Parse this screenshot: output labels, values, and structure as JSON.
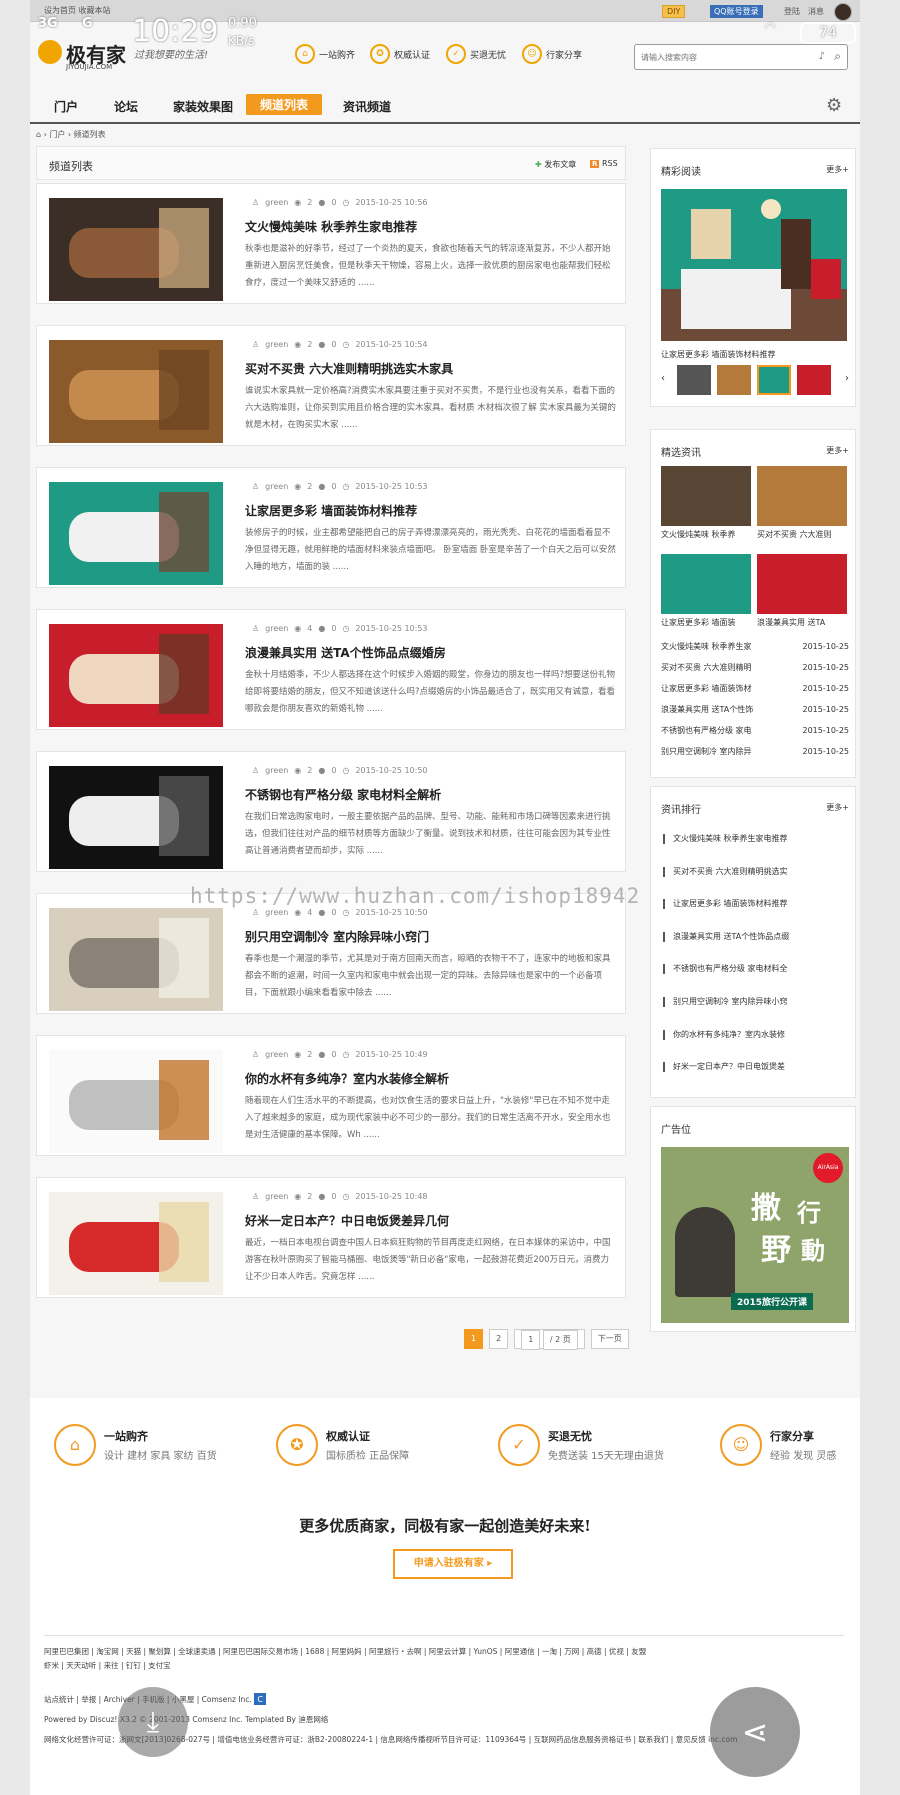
{
  "status_bar": {
    "network1": "3G",
    "network2": "G",
    "time": "10:29",
    "speed": "0.90",
    "speed_unit": "KB/s",
    "battery": "74",
    "top_left": "设为首页  收藏本站"
  },
  "topbar": {
    "diy": "DIY",
    "qq": "QQ账号登录",
    "login": "登陆",
    "message": "消息"
  },
  "logo": {
    "name": "极有家",
    "sub": "JIYOUJIA.COM",
    "slogan": "过我想要的生活!"
  },
  "features": [
    {
      "label": "一站购齐"
    },
    {
      "label": "权威认证"
    },
    {
      "label": "买退无忧"
    },
    {
      "label": "行家分享"
    }
  ],
  "search": {
    "placeholder": "请输入搜索内容"
  },
  "nav": [
    {
      "label": "门户"
    },
    {
      "label": "论坛"
    },
    {
      "label": "家装效果图"
    },
    {
      "label": "频道列表"
    },
    {
      "label": "资讯频道"
    }
  ],
  "breadcrumb": {
    "home": "门户",
    "current": "频道列表"
  },
  "main": {
    "title": "频道列表",
    "post": "发布文章",
    "rss": "RSS",
    "articles": [
      {
        "author": "green",
        "views": "2",
        "comments": "0",
        "date": "2015-10-25 10:56",
        "title": "文火慢炖美味 秋季养生家电推荐",
        "desc": "秋季也是滋补的好季节，经过了一个炎热的夏天，食欲也随着天气的转凉逐渐复苏，不少人都开始重新进入厨房烹饪美食，但是秋季天干物燥，容易上火，选择一款优质的厨房家电也能帮我们轻松食疗，度过一个美味又舒适的 ......"
      },
      {
        "author": "green",
        "views": "2",
        "comments": "0",
        "date": "2015-10-25 10:54",
        "title": "买对不买贵 六大准则精明挑选实木家具",
        "desc": "谁说实木家具就一定价格高?消费实木家具要注重于买对不买贵，不是行业也没有关系，看看下面的六大选购准则，让你买到实用且价格合理的实木家具。看材质 木材档次很了解      实木家具最为关键的就是木材，在购买实木家 ......"
      },
      {
        "author": "green",
        "views": "2",
        "comments": "0",
        "date": "2015-10-25 10:53",
        "title": "让家居更多彩 墙面装饰材料推荐",
        "desc": "装修房子的时候，业主都希望能把自己的房子弄得漂漂亮亮的，雨光秃秃、白花花的墙面看着显不净但显得无趣，就用鲜艳的墙面材料来装点墙面吧。      卧室墙面      卧室是辛苦了一个白天之后可以安然入睡的地方，墙面的装 ......"
      },
      {
        "author": "green",
        "views": "4",
        "comments": "0",
        "date": "2015-10-25 10:53",
        "title": "浪漫兼具实用 送TA个性饰品点缀婚房",
        "desc": "金秋十月结婚季，不少人都选择在这个时候步入婚姻的殿堂，你身边的朋友也一样吗?想要送份礼物给即将要结婚的朋友，但又不知道该送什么吗?点缀婚房的小饰品最适合了，既实用又有诚意，看看哪款会是你朋友喜欢的新婚礼物 ......"
      },
      {
        "author": "green",
        "views": "2",
        "comments": "0",
        "date": "2015-10-25 10:50",
        "title": "不锈钢也有严格分级 家电材料全解析",
        "desc": "在我们日常选购家电时，一般主要依据产品的品牌、型号、功能、能耗和市场口碑等因素来进行挑选，但我们往往对产品的细节材质等方面缺少了衡量。说到技术和材质，往往可能会因为其专业性高让普通消费者望而却步，实际 ......"
      },
      {
        "author": "green",
        "views": "4",
        "comments": "0",
        "date": "2015-10-25 10:50",
        "title": "别只用空调制冷 室内除异味小窍门",
        "desc": "春季也是一个潮湿的季节，尤其是对于南方回南天而言，晾晒的衣物干不了，连家中的地板和家具都会不断的返潮，时间一久室内和家电中就会出现一定的异味。去除异味也是家中的一个必备项目，下面就跟小编来看看家中除去 ......"
      },
      {
        "author": "green",
        "views": "2",
        "comments": "0",
        "date": "2015-10-25 10:49",
        "title": "你的水杯有多纯净？室内水装修全解析",
        "desc": "随着现在人们生活水平的不断提高，也对饮食生活的要求日益上升，\"水装修\"早已在不知不觉中走入了越来越多的家庭，成为现代家装中必不可少的一部分。我们的日常生活离不开水，安全用水也是对生活健康的基本保障。Wh ......"
      },
      {
        "author": "green",
        "views": "2",
        "comments": "0",
        "date": "2015-10-25 10:48",
        "title": "好米一定日本产？中日电饭煲差异几何",
        "desc": "最近，一档日本电视台调查中国人日本疯狂购物的节目再度走红网络，在日本媒体的采访中，中国游客在秋叶原购买了智能马桶圈、电饭煲等\"新日必备\"家电，一起鼓游花费近200万日元，消费力让不少日本人咋舌。究竟怎样 ......"
      }
    ],
    "pager": {
      "page1": "1",
      "page2": "2",
      "input": "1",
      "total": "/ 2 页",
      "next": "下一页"
    }
  },
  "sidebar": {
    "featured": {
      "title": "精彩阅读",
      "more": "更多+",
      "caption": "让家居更多彩 墙面装饰材料推荐"
    },
    "news": {
      "title": "精选资讯",
      "more": "更多+",
      "thumbs": [
        {
          "caption": "文火慢炖美味 秋季养"
        },
        {
          "caption": "买对不买贵 六大准则"
        },
        {
          "caption": "让家居更多彩 墙面装"
        },
        {
          "caption": "浪漫兼具实用 送TA"
        }
      ],
      "items": [
        {
          "t": "文火慢炖美味 秋季养生家",
          "d": "2015-10-25"
        },
        {
          "t": "买对不买贵 六大准则精明",
          "d": "2015-10-25"
        },
        {
          "t": "让家居更多彩 墙面装饰材",
          "d": "2015-10-25"
        },
        {
          "t": "浪漫兼具实用 送TA个性饰",
          "d": "2015-10-25"
        },
        {
          "t": "不锈钢也有严格分级 家电",
          "d": "2015-10-25"
        },
        {
          "t": "别只用空调制冷 室内除异",
          "d": "2015-10-25"
        }
      ]
    },
    "rank": {
      "title": "资讯排行",
      "more": "更多+",
      "items": [
        "文火慢炖美味 秋季养生家电推荐",
        "买对不买贵 六大准则精明挑选实",
        "让家居更多彩 墙面装饰材料推荐",
        "浪漫兼具实用 送TA个性饰品点缀",
        "不锈钢也有严格分级 家电材料全",
        "别只用空调制冷 室内除异味小窍",
        "你的水杯有多纯净？室内水装修",
        "好米一定日本产？中日电饭煲差"
      ]
    },
    "ad": {
      "title": "广告位",
      "brand": "AirAsia",
      "big1": "撒",
      "big2": "野",
      "big3": "行",
      "big4": "動",
      "banner": "2015旅行公开课"
    }
  },
  "watermark": "https://www.huzhan.com/ishop18942",
  "footer": {
    "features": [
      {
        "h": "一站购齐",
        "s": "设计 建材 家具 家纺 百货"
      },
      {
        "h": "权威认证",
        "s": "国标质检 正品保障"
      },
      {
        "h": "买退无忧",
        "s": "免费送装 15天无理由退货"
      },
      {
        "h": "行家分享",
        "s": "经验 发现 灵感"
      }
    ],
    "slogan": "更多优质商家，同极有家一起创造美好未来!",
    "cta": "申请入驻极有家 ▸",
    "links1": "阿里巴巴集团 | 淘宝网 | 天猫 | 聚划算 | 全球速卖通 | 阿里巴巴国际交易市场 | 1688 | 阿里妈妈 | 阿里旅行・去啊 | 阿里云计算 | YunOS | 阿里通信 | 一淘 | 万网 | 高德 | 优视 | 友盟",
    "links2": "虾米 | 天天动听 | 来往 | 钉钉 | 支付宝",
    "stats": "站点统计 | 举报 | Archiver | 手机版 | 小黑屋 | Comsenz Inc.",
    "powered": "Powered by Discuz! X3.2 © 2001-2013 Comsenz Inc. Templated By 迪恩网络",
    "license": "网络文化经营许可证：浙网文[2013]0268-027号 | 增值电信业务经营许可证：浙B2-20080224-1 | 信息网络传播视听节目许可证：1109364号 | 互联网药品信息服务资格证书 | 联系我们 | 意见反馈 inc.com"
  },
  "colors": {
    "accent": "#f39a1e",
    "page_bg": "#f6f6f6"
  }
}
